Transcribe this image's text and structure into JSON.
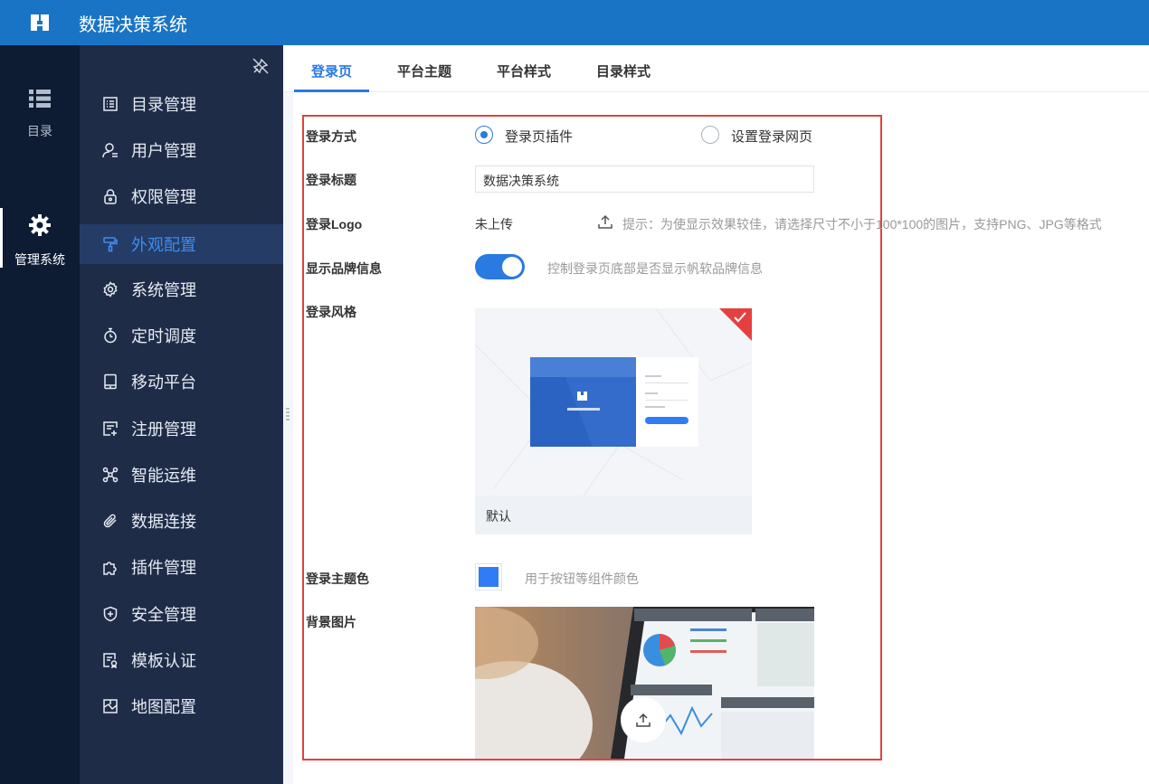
{
  "header": {
    "title": "数据决策系统"
  },
  "rail": [
    {
      "label": "目录",
      "icon": "list-icon"
    },
    {
      "label": "管理系统",
      "icon": "gear-icon",
      "active": true
    }
  ],
  "sidebar": {
    "items": [
      {
        "label": "目录管理",
        "icon": "catalog-icon"
      },
      {
        "label": "用户管理",
        "icon": "user-icon"
      },
      {
        "label": "权限管理",
        "icon": "lock-icon"
      },
      {
        "label": "外观配置",
        "icon": "paint-roller-icon",
        "active": true
      },
      {
        "label": "系统管理",
        "icon": "gear-icon"
      },
      {
        "label": "定时调度",
        "icon": "timer-icon"
      },
      {
        "label": "移动平台",
        "icon": "tablet-icon"
      },
      {
        "label": "注册管理",
        "icon": "register-icon"
      },
      {
        "label": "智能运维",
        "icon": "network-icon"
      },
      {
        "label": "数据连接",
        "icon": "paperclip-icon"
      },
      {
        "label": "插件管理",
        "icon": "puzzle-icon"
      },
      {
        "label": "安全管理",
        "icon": "shield-icon"
      },
      {
        "label": "模板认证",
        "icon": "template-icon"
      },
      {
        "label": "地图配置",
        "icon": "map-icon"
      }
    ]
  },
  "tabs": [
    {
      "label": "登录页",
      "active": true
    },
    {
      "label": "平台主题"
    },
    {
      "label": "平台样式"
    },
    {
      "label": "目录样式"
    }
  ],
  "form": {
    "login_method": {
      "label": "登录方式",
      "options": [
        {
          "label": "登录页插件",
          "selected": true
        },
        {
          "label": "设置登录网页",
          "selected": false
        }
      ]
    },
    "login_title": {
      "label": "登录标题",
      "value": "数据决策系统"
    },
    "login_logo": {
      "label": "登录Logo",
      "status": "未上传",
      "hint": "提示：为使显示效果较佳，请选择尺寸不小于100*100的图片，支持PNG、JPG等格式"
    },
    "brand_info": {
      "label": "显示品牌信息",
      "enabled": true,
      "hint": "控制登录页底部是否显示帆软品牌信息"
    },
    "login_style": {
      "label": "登录风格",
      "card_label": "默认",
      "selected": true
    },
    "theme_color": {
      "label": "登录主题色",
      "color": "#2f7cf6",
      "hint": "用于按钮等组件颜色"
    },
    "background": {
      "label": "背景图片"
    }
  },
  "colors": {
    "header": "#1a74c6",
    "rail": "#0d1b33",
    "sidebar": "#1e2c48",
    "accent": "#2a7ae2",
    "highlight_border": "#e54040"
  }
}
